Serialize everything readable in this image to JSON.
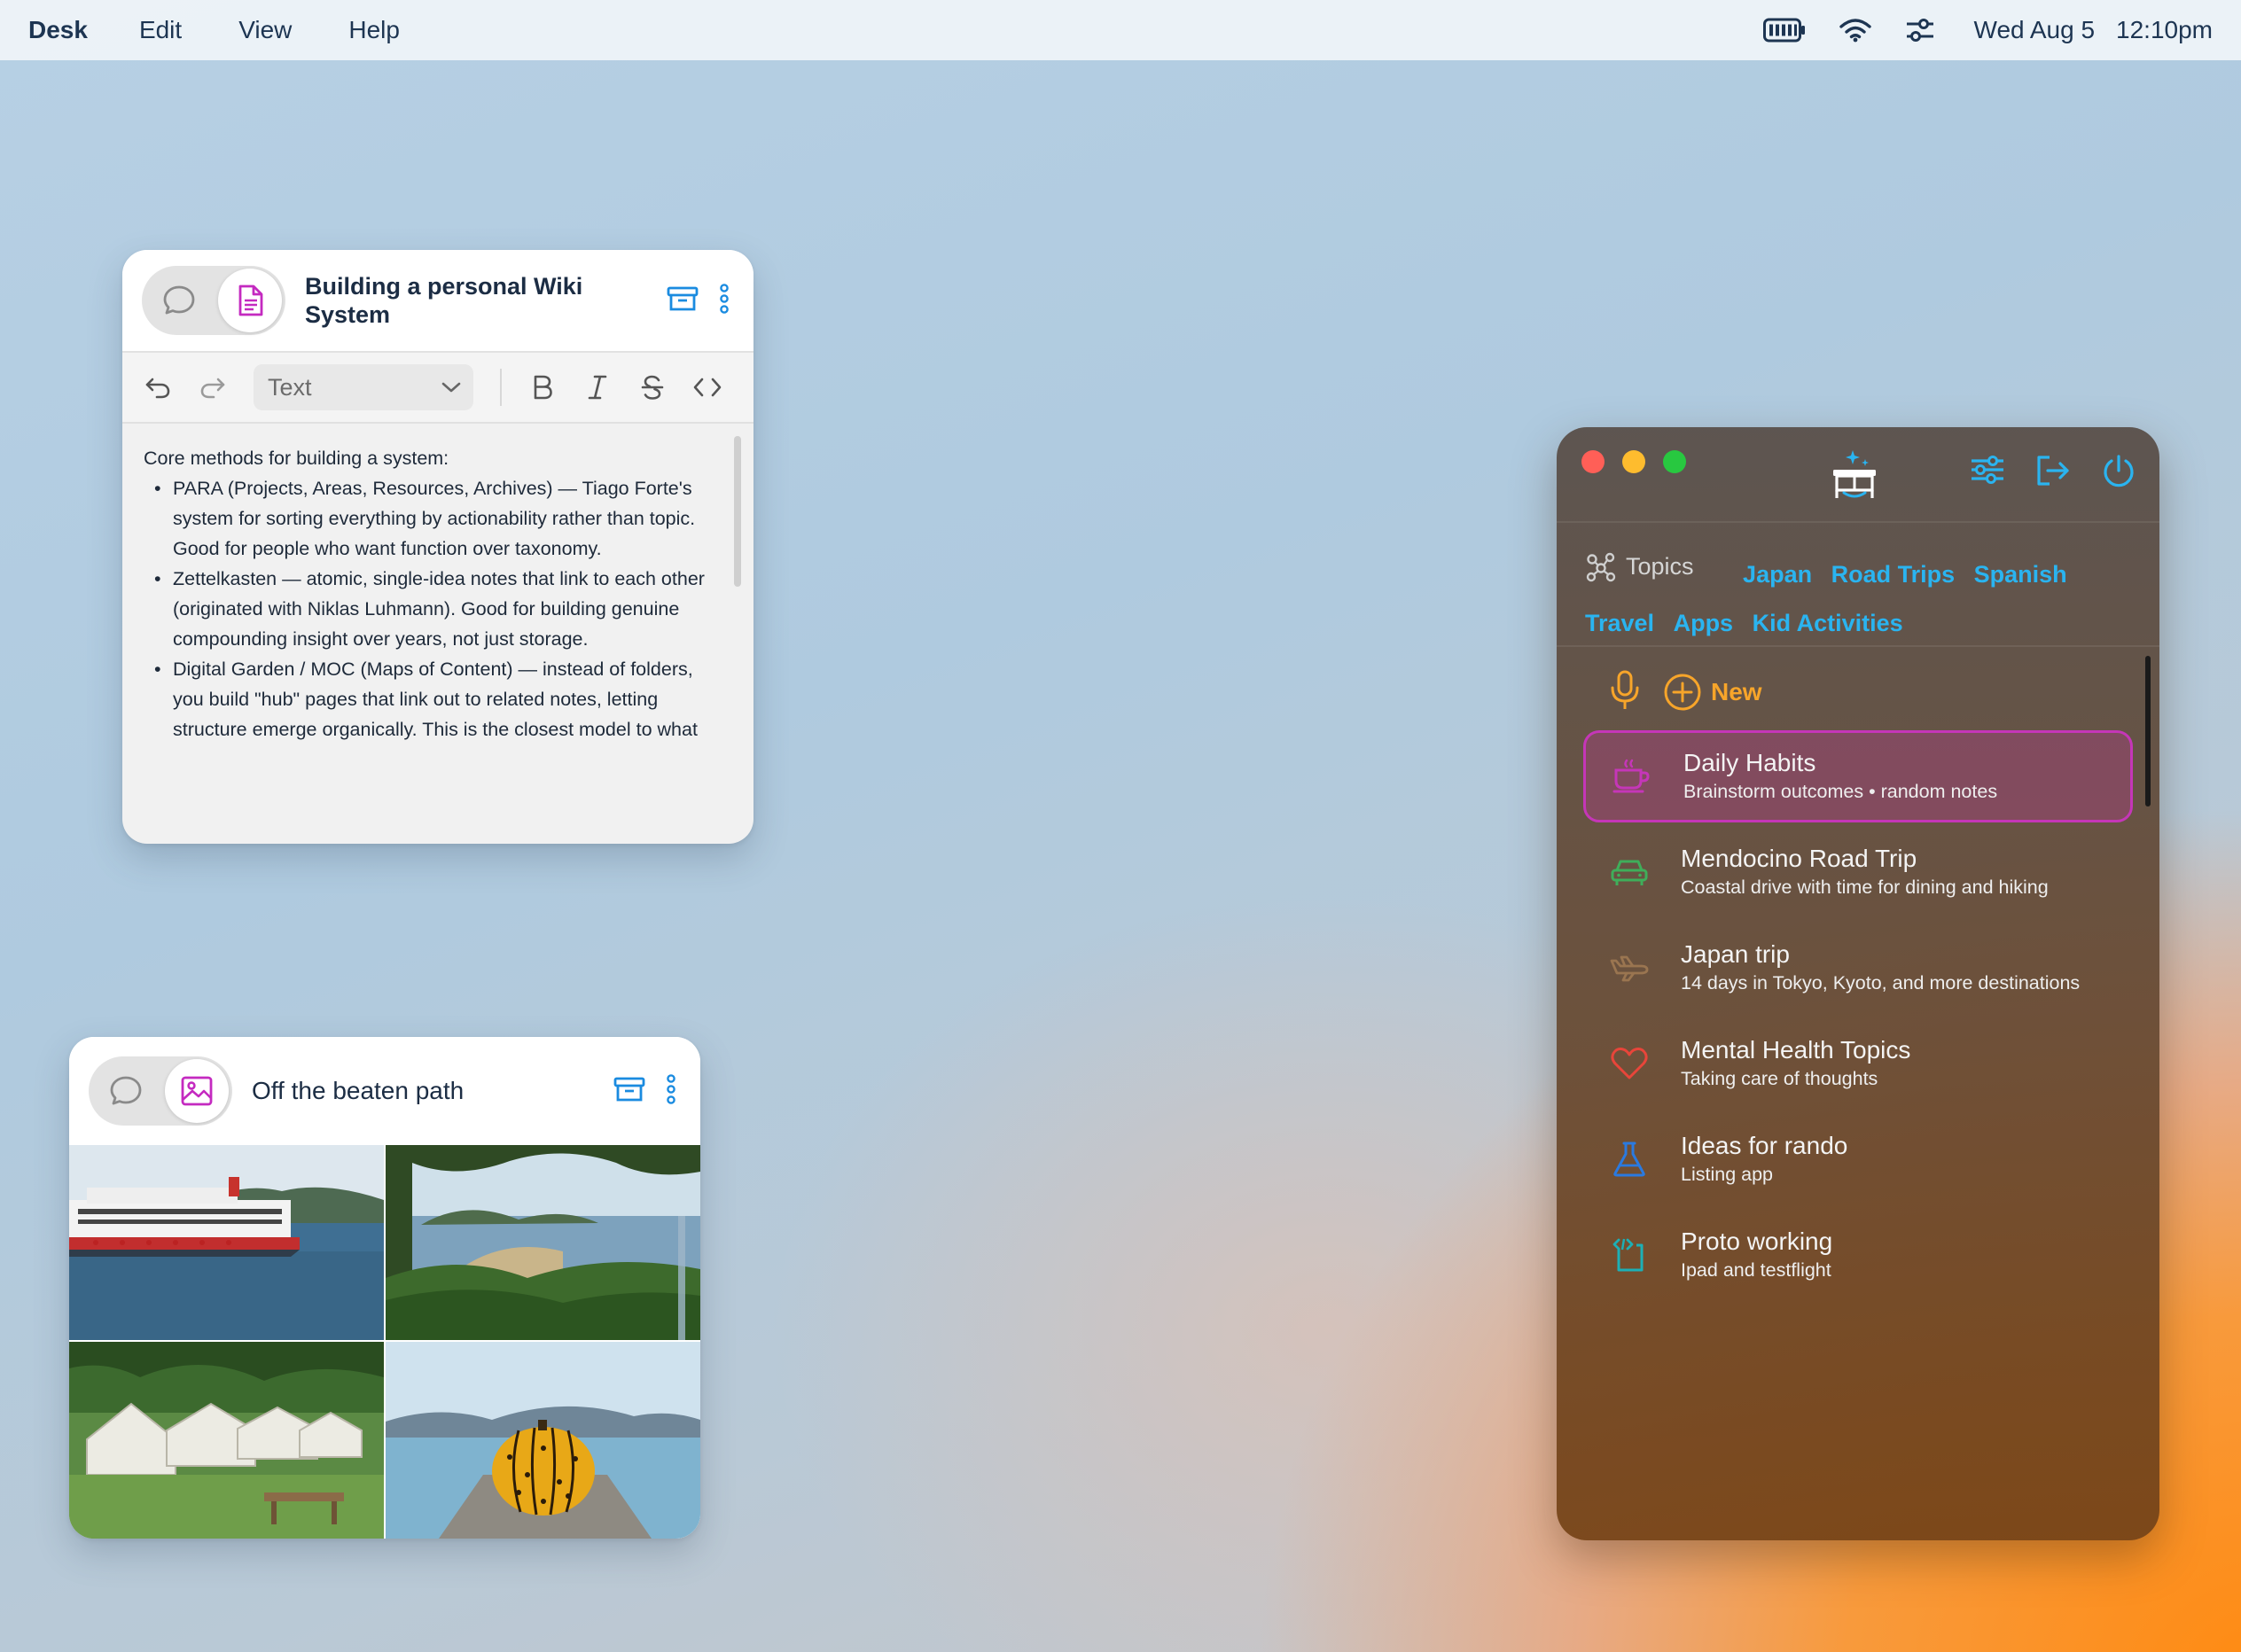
{
  "menubar": {
    "app_name": "Desk",
    "menus": [
      "Edit",
      "View",
      "Help"
    ],
    "status_icons": [
      "battery-icon",
      "wifi-icon",
      "control-sliders-icon"
    ],
    "date": "Wed Aug 5",
    "time": "12:10pm"
  },
  "wiki_note": {
    "title": "Building a personal Wiki System",
    "mode": "document",
    "toolbar": {
      "format_value": "Text",
      "buttons": [
        "undo",
        "redo",
        "bold",
        "italic",
        "strikethrough",
        "code"
      ]
    },
    "intro": "Core methods for building a system:",
    "bullets": [
      "PARA (Projects, Areas, Resources, Archives) — Tiago Forte's system for sorting everything by actionability rather than topic. Good for people who want function over taxonomy.",
      "Zettelkasten — atomic, single-idea notes that link to each other (originated with Niklas Luhmann). Good for building genuine compounding insight over years, not just storage.",
      "Digital Garden / MOC (Maps of Content) — instead of folders, you build \"hub\" pages that link out to related notes, letting structure emerge organically. This is the closest model to what"
    ]
  },
  "photo_note": {
    "title": "Off the beaten path",
    "mode": "image",
    "photos": [
      "ferry",
      "coastal-view",
      "yurts",
      "yellow-pumpkin"
    ]
  },
  "panel": {
    "topics_label": "Topics",
    "topics": [
      "Japan",
      "Road Trips",
      "Spanish",
      "Travel",
      "Apps",
      "Kid Activities"
    ],
    "new_label": "New",
    "items": [
      {
        "title": "Daily Habits",
        "subtitle": "Brainstorm outcomes • random notes",
        "icon": "coffee-cup-icon",
        "active": true
      },
      {
        "title": "Mendocino Road Trip",
        "subtitle": "Coastal drive with time for dining and hiking",
        "icon": "car-icon"
      },
      {
        "title": "Japan trip",
        "subtitle": "14 days in Tokyo, Kyoto, and more destinations",
        "icon": "airplane-icon"
      },
      {
        "title": "Mental Health Topics",
        "subtitle": "Taking care of thoughts",
        "icon": "heart-icon"
      },
      {
        "title": "Ideas for rando",
        "subtitle": "Listing app",
        "icon": "flask-icon"
      },
      {
        "title": "Proto working",
        "subtitle": "Ipad and testflight",
        "icon": "code-icon"
      }
    ],
    "colors": {
      "tag": "#2ab4f0",
      "new": "#f7a52a",
      "active_border": "#c536b8"
    }
  }
}
